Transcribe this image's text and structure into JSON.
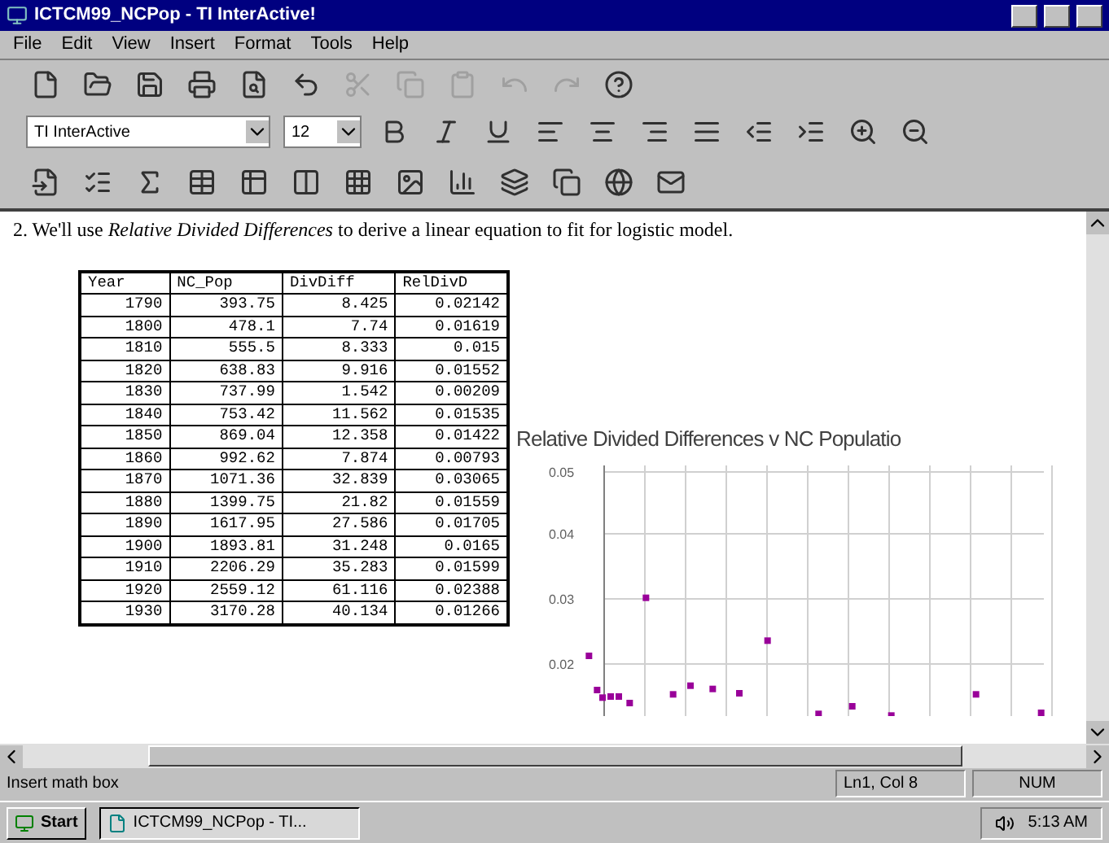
{
  "window": {
    "title": "ICTCM99_NCPop - TI InterActive!"
  },
  "menu": [
    "File",
    "Edit",
    "View",
    "Insert",
    "Format",
    "Tools",
    "Help"
  ],
  "format_bar": {
    "font": "TI InterActive",
    "size": "12"
  },
  "document": {
    "sentence": "2. We'll use *Relative Divided Differences* to derive a linear equation to fit for logistic model.",
    "table": {
      "columns": [
        "Year",
        "NC_Pop",
        "DivDiff",
        "RelDivD"
      ],
      "rows": [
        [
          "1790",
          "393.75",
          "8.425",
          "0.02142"
        ],
        [
          "1800",
          "478.1",
          "7.74",
          "0.01619"
        ],
        [
          "1810",
          "555.5",
          "8.333",
          "0.015"
        ],
        [
          "1820",
          "638.83",
          "9.916",
          "0.01552"
        ],
        [
          "1830",
          "737.99",
          "1.542",
          "0.00209"
        ],
        [
          "1840",
          "753.42",
          "11.562",
          "0.01535"
        ],
        [
          "1850",
          "869.04",
          "12.358",
          "0.01422"
        ],
        [
          "1860",
          "992.62",
          "7.874",
          "0.00793"
        ],
        [
          "1870",
          "1071.36",
          "32.839",
          "0.03065"
        ],
        [
          "1880",
          "1399.75",
          "21.82",
          "0.01559"
        ],
        [
          "1890",
          "1617.95",
          "27.586",
          "0.01705"
        ],
        [
          "1900",
          "1893.81",
          "31.248",
          "0.0165"
        ],
        [
          "1910",
          "2206.29",
          "35.283",
          "0.01599"
        ],
        [
          "1920",
          "2559.12",
          "61.116",
          "0.02388"
        ],
        [
          "1930",
          "3170.28",
          "40.134",
          "0.01266"
        ]
      ]
    },
    "chart": {
      "title": "Relative Divided Differences v NC Populatio",
      "y_axis_labels": [
        "0.05",
        "0.04",
        "0.03",
        "0.02"
      ]
    }
  },
  "status_bar": {
    "message": "Insert math box",
    "position": "Ln1, Col 8",
    "num": "NUM"
  },
  "taskbar": {
    "start": "Start",
    "task": "ICTCM99_NCPop - TI...",
    "time": "5:13 AM"
  }
}
